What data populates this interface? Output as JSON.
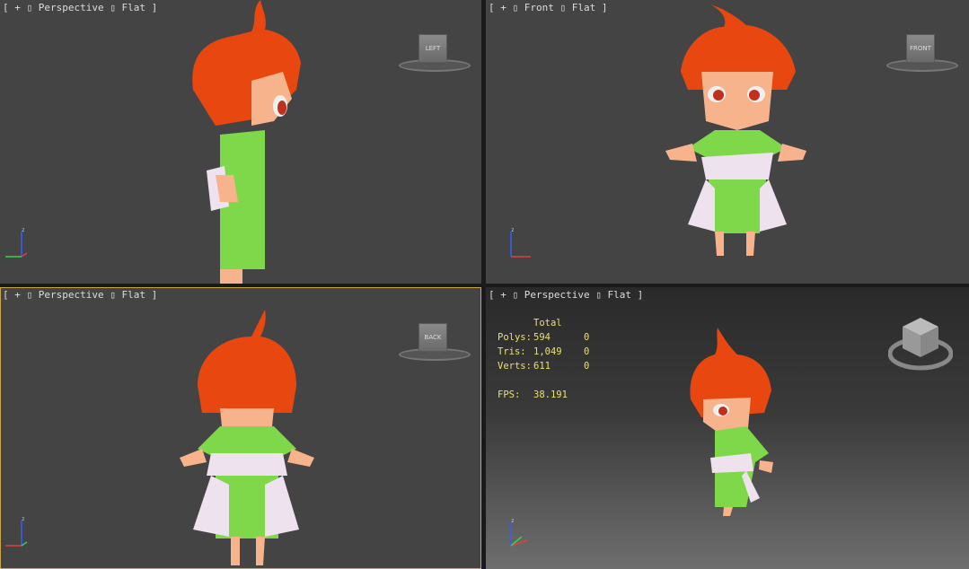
{
  "viewports": {
    "top_left": {
      "bracket_open": "[",
      "plus": "+",
      "box": "▯",
      "view": "Perspective",
      "box2": "▯",
      "shading": "Flat",
      "bracket_close": "]",
      "cube_label": "LEFT"
    },
    "top_right": {
      "bracket_open": "[",
      "plus": "+",
      "box": "▯",
      "view": "Front",
      "box2": "▯",
      "shading": "Flat",
      "bracket_close": "]",
      "cube_label": "FRONT"
    },
    "bottom_left": {
      "bracket_open": "[",
      "plus": "+",
      "box": "▯",
      "view": "Perspective",
      "box2": "▯",
      "shading": "Flat",
      "bracket_close": "]",
      "cube_label": "BACK"
    },
    "bottom_right": {
      "bracket_open": "[",
      "plus": "+",
      "box": "▯",
      "view": "Perspective",
      "box2": "▯",
      "shading": "Flat",
      "bracket_close": "]",
      "cube_label": ""
    }
  },
  "stats": {
    "header": "Total",
    "polys_label": "Polys:",
    "polys_total": "594",
    "polys_sel": "0",
    "tris_label": "Tris:",
    "tris_total": "1,049",
    "tris_sel": "0",
    "verts_label": "Verts:",
    "verts_total": "611",
    "verts_sel": "0",
    "fps_label": "FPS:",
    "fps_value": "38.191"
  },
  "axis": {
    "z": "z",
    "x": "x",
    "y": "y"
  },
  "colors": {
    "viewport_bg": "#444444",
    "active_border": "#c8a84b",
    "stats_text": "#e8e26a",
    "hair": "#e8480f",
    "robe": "#7ed84a",
    "sash": "#efe2ef",
    "skin": "#f7b48c"
  }
}
